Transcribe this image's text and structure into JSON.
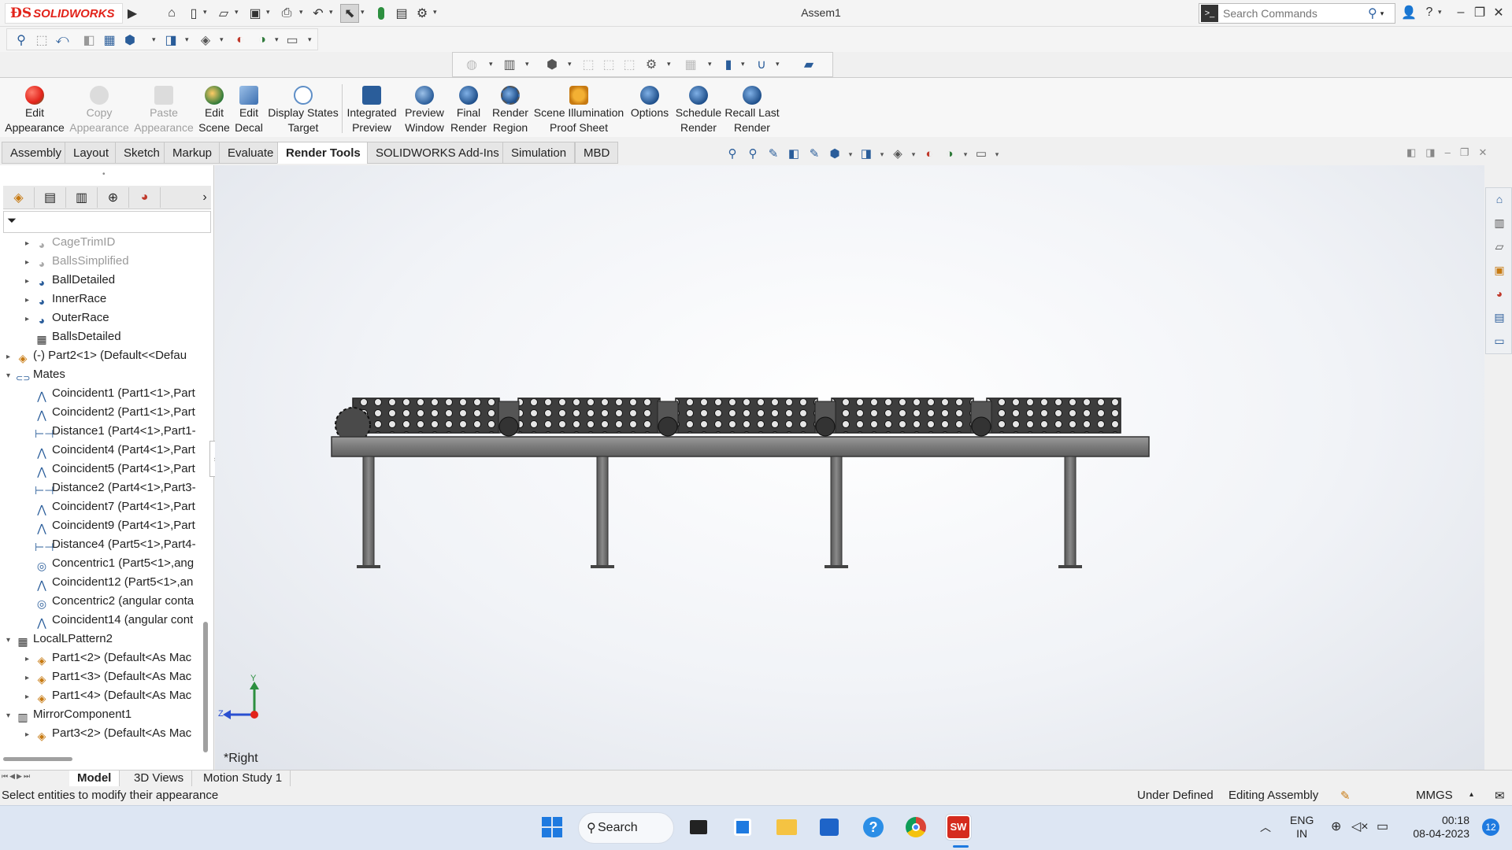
{
  "app": {
    "logo_brand": "SOLIDWORKS",
    "document_title": "Assem1",
    "search_placeholder": "Search Commands"
  },
  "command_manager": {
    "buttons": [
      {
        "id": "edit-appearance",
        "label": "Edit\nAppearance",
        "line1": "Edit",
        "line2": "Appearance",
        "enabled": true,
        "icon": "edit-appearance-icon",
        "color": "#e2231a"
      },
      {
        "id": "copy-appearance",
        "line1": "Copy",
        "line2": "Appearance",
        "enabled": false,
        "icon": "copy-appearance-icon",
        "color": "#c8c8c8"
      },
      {
        "id": "paste-appearance",
        "line1": "Paste",
        "line2": "Appearance",
        "enabled": false,
        "icon": "paste-appearance-icon",
        "color": "#c8c8c8"
      },
      {
        "id": "edit-scene",
        "line1": "Edit",
        "line2": "Scene",
        "enabled": true,
        "icon": "edit-scene-icon",
        "color": "#2f7a3a"
      },
      {
        "id": "edit-decal",
        "line1": "Edit",
        "line2": "Decal",
        "enabled": true,
        "icon": "edit-decal-icon",
        "color": "#3d6fb0"
      },
      {
        "id": "display-states-target",
        "line1": "Display States",
        "line2": "Target",
        "enabled": true,
        "icon": "display-states-target-icon",
        "color": "#5f8fc7"
      },
      {
        "id": "integrated-preview",
        "line1": "Integrated",
        "line2": "Preview",
        "enabled": true,
        "icon": "integrated-preview-icon",
        "color": "#2a5d9a"
      },
      {
        "id": "preview-window",
        "line1": "Preview",
        "line2": "Window",
        "enabled": true,
        "icon": "preview-window-icon",
        "color": "#2a5d9a"
      },
      {
        "id": "final-render",
        "line1": "Final",
        "line2": "Render",
        "enabled": true,
        "icon": "final-render-icon",
        "color": "#1f4f8a"
      },
      {
        "id": "render-region",
        "line1": "Render",
        "line2": "Region",
        "enabled": true,
        "icon": "render-region-icon",
        "color": "#1f4f8a"
      },
      {
        "id": "scene-illumination-proof-sheet",
        "line1": "Scene Illumination",
        "line2": "Proof Sheet",
        "enabled": true,
        "icon": "proof-sheet-icon",
        "color": "#c77a12"
      },
      {
        "id": "options",
        "line1": "Options",
        "line2": "",
        "enabled": true,
        "icon": "options-icon",
        "color": "#1f4f8a"
      },
      {
        "id": "schedule-render",
        "line1": "Schedule",
        "line2": "Render",
        "enabled": true,
        "icon": "schedule-render-icon",
        "color": "#1f4f8a"
      },
      {
        "id": "recall-last-render",
        "line1": "Recall Last",
        "line2": "Render",
        "enabled": true,
        "icon": "recall-last-render-icon",
        "color": "#1f4f8a"
      }
    ]
  },
  "tabs": [
    "Assembly",
    "Layout",
    "Sketch",
    "Markup",
    "Evaluate",
    "Render Tools",
    "SOLIDWORKS Add-Ins",
    "Simulation",
    "MBD"
  ],
  "active_tab": "Render Tools",
  "feature_tree": {
    "items": [
      {
        "label": "CageTrimID",
        "indent": 1,
        "expander": "▸",
        "icon": "part-icon",
        "suppressed": true
      },
      {
        "label": "BallsSimplified",
        "indent": 1,
        "expander": "▸",
        "icon": "part-icon",
        "suppressed": true
      },
      {
        "label": "BallDetailed",
        "indent": 1,
        "expander": "▸",
        "icon": "part-icon",
        "suppressed": false
      },
      {
        "label": "InnerRace",
        "indent": 1,
        "expander": "▸",
        "icon": "part-icon",
        "suppressed": false
      },
      {
        "label": "OuterRace",
        "indent": 1,
        "expander": "▸",
        "icon": "part-icon",
        "suppressed": false
      },
      {
        "label": "BallsDetailed",
        "indent": 1,
        "expander": "",
        "icon": "pattern-icon",
        "suppressed": false
      },
      {
        "label": "(-) Part2<1> (Default<<Defau",
        "indent": 0,
        "expander": "▸",
        "icon": "component-icon",
        "suppressed": false
      },
      {
        "label": "Mates",
        "indent": 0,
        "expander": "▾",
        "icon": "mates-icon",
        "suppressed": false
      },
      {
        "label": "Coincident1 (Part1<1>,Part",
        "indent": 1,
        "expander": "",
        "icon": "coincident-icon",
        "suppressed": false
      },
      {
        "label": "Coincident2 (Part1<1>,Part",
        "indent": 1,
        "expander": "",
        "icon": "coincident-icon",
        "suppressed": false
      },
      {
        "label": "Distance1 (Part4<1>,Part1-",
        "indent": 1,
        "expander": "",
        "icon": "distance-icon",
        "suppressed": false
      },
      {
        "label": "Coincident4 (Part4<1>,Part",
        "indent": 1,
        "expander": "",
        "icon": "coincident-icon",
        "suppressed": false
      },
      {
        "label": "Coincident5 (Part4<1>,Part",
        "indent": 1,
        "expander": "",
        "icon": "coincident-icon",
        "suppressed": false
      },
      {
        "label": "Distance2 (Part4<1>,Part3-",
        "indent": 1,
        "expander": "",
        "icon": "distance-icon",
        "suppressed": false
      },
      {
        "label": "Coincident7 (Part4<1>,Part",
        "indent": 1,
        "expander": "",
        "icon": "coincident-icon",
        "suppressed": false
      },
      {
        "label": "Coincident9 (Part4<1>,Part",
        "indent": 1,
        "expander": "",
        "icon": "coincident-icon",
        "suppressed": false
      },
      {
        "label": "Distance4 (Part5<1>,Part4-",
        "indent": 1,
        "expander": "",
        "icon": "distance-icon",
        "suppressed": false
      },
      {
        "label": "Concentric1 (Part5<1>,ang",
        "indent": 1,
        "expander": "",
        "icon": "concentric-icon",
        "suppressed": false
      },
      {
        "label": "Coincident12 (Part5<1>,an",
        "indent": 1,
        "expander": "",
        "icon": "coincident-icon",
        "suppressed": false
      },
      {
        "label": "Concentric2 (angular conta",
        "indent": 1,
        "expander": "",
        "icon": "concentric-icon",
        "suppressed": false
      },
      {
        "label": "Coincident14 (angular cont",
        "indent": 1,
        "expander": "",
        "icon": "coincident-icon",
        "suppressed": false
      },
      {
        "label": "LocalLPattern2",
        "indent": 0,
        "expander": "▾",
        "icon": "pattern-icon",
        "suppressed": false
      },
      {
        "label": "Part1<2> (Default<As Mac",
        "indent": 1,
        "expander": "▸",
        "icon": "component-icon",
        "suppressed": false
      },
      {
        "label": "Part1<3> (Default<As Mac",
        "indent": 1,
        "expander": "▸",
        "icon": "component-icon",
        "suppressed": false
      },
      {
        "label": "Part1<4> (Default<As Mac",
        "indent": 1,
        "expander": "▸",
        "icon": "component-icon",
        "suppressed": false
      },
      {
        "label": "MirrorComponent1",
        "indent": 0,
        "expander": "▾",
        "icon": "mirror-icon",
        "suppressed": false
      },
      {
        "label": "Part3<2> (Default<As Mac",
        "indent": 1,
        "expander": "▸",
        "icon": "component-icon",
        "suppressed": false
      }
    ]
  },
  "viewport": {
    "view_name": "*Right",
    "triad": {
      "y_label": "Y",
      "z_label": "Z"
    }
  },
  "bottom_tabs": [
    "Model",
    "3D Views",
    "Motion Study 1"
  ],
  "active_bottom_tab": "Model",
  "status_bar": {
    "message": "Select entities to modify their appearance",
    "definition": "Under Defined",
    "mode": "Editing Assembly",
    "units": "MMGS"
  },
  "taskbar": {
    "search_label": "Search",
    "language_line1": "ENG",
    "language_line2": "IN",
    "time": "00:18",
    "date": "08-04-2023",
    "notification_count": "12",
    "solidworks_badge": "SW"
  }
}
